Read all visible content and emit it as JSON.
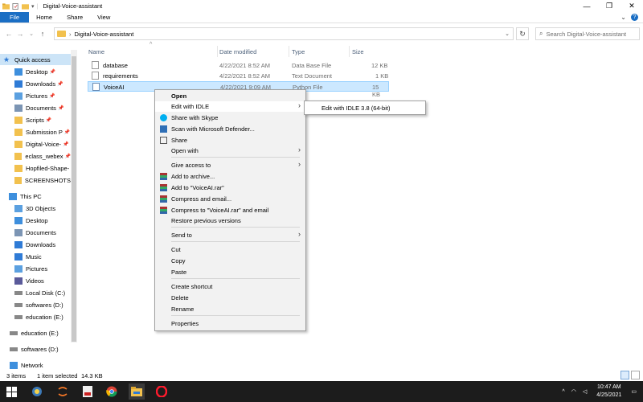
{
  "window": {
    "title": "Digital-Voice-assistant",
    "controls": {
      "minimize": "—",
      "maximize": "❐",
      "close": "✕"
    }
  },
  "ribbon": {
    "tabs": [
      {
        "label": "File"
      },
      {
        "label": "Home"
      },
      {
        "label": "Share"
      },
      {
        "label": "View"
      }
    ],
    "collapse_glyph": "⌄",
    "help_glyph": "?"
  },
  "address": {
    "back": "←",
    "forward": "→",
    "recent": "⌄",
    "up": "↑",
    "separator": "›",
    "path": "Digital-Voice-assistant",
    "dropdown": "⌄",
    "refresh": "↻",
    "search_placeholder": "Search Digital-Voice-assistant",
    "search_glyph": "⌕"
  },
  "nav": {
    "pin_glyph": "📌",
    "items": [
      {
        "label": "Quick access",
        "icon": "star-icon",
        "color": "#2f7bd6"
      },
      {
        "label": "Desktop",
        "icon": "desktop-icon",
        "color": "#3e8fdd",
        "pinned": true
      },
      {
        "label": "Downloads",
        "icon": "download-icon",
        "color": "#2f7bd6",
        "pinned": true
      },
      {
        "label": "Pictures",
        "icon": "pictures-icon",
        "color": "#5ba0e0",
        "pinned": true
      },
      {
        "label": "Documents",
        "icon": "documents-icon",
        "color": "#7c95b4",
        "pinned": true
      },
      {
        "label": "Scripts",
        "icon": "folder-icon",
        "color": "#f2c14e",
        "pinned": true
      },
      {
        "label": "Submission P",
        "icon": "folder-icon",
        "color": "#f2c14e",
        "pinned": true
      },
      {
        "label": "Digital-Voice-",
        "icon": "folder-icon",
        "color": "#f2c14e",
        "pinned": true
      },
      {
        "label": "eclass_webex",
        "icon": "folder-icon",
        "color": "#f2c14e",
        "pinned": true
      },
      {
        "label": "Hopfiled-Shape-",
        "icon": "folder-icon",
        "color": "#f2c14e"
      },
      {
        "label": "SCREENSHOTS",
        "icon": "folder-icon",
        "color": "#f2c14e"
      },
      {
        "label": "This PC",
        "icon": "pc-icon",
        "color": "#3e8fdd"
      },
      {
        "label": "3D Objects",
        "icon": "3d-objects-icon",
        "color": "#5ba0e0"
      },
      {
        "label": "Desktop",
        "icon": "desktop-icon",
        "color": "#3e8fdd"
      },
      {
        "label": "Documents",
        "icon": "documents-icon",
        "color": "#7c95b4"
      },
      {
        "label": "Downloads",
        "icon": "download-icon",
        "color": "#2f7bd6"
      },
      {
        "label": "Music",
        "icon": "music-icon",
        "color": "#2f7bd6"
      },
      {
        "label": "Pictures",
        "icon": "pictures-icon",
        "color": "#5ba0e0"
      },
      {
        "label": "Videos",
        "icon": "videos-icon",
        "color": "#5a5a9a"
      },
      {
        "label": "Local Disk (C:)",
        "icon": "drive-icon",
        "color": "#888888"
      },
      {
        "label": "softwares (D:)",
        "icon": "drive-icon",
        "color": "#888888"
      },
      {
        "label": "education (E:)",
        "icon": "drive-icon",
        "color": "#888888"
      },
      {
        "label": "education (E:)",
        "icon": "drive-icon",
        "color": "#888888"
      },
      {
        "label": "softwares (D:)",
        "icon": "drive-icon",
        "color": "#888888"
      },
      {
        "label": "Network",
        "icon": "network-icon",
        "color": "#3e8fdd"
      }
    ]
  },
  "files": {
    "sort_glyph": "^",
    "columns": [
      "Name",
      "Date modified",
      "Type",
      "Size"
    ],
    "rows": [
      {
        "name": "database",
        "date": "4/22/2021 8:52 AM",
        "type": "Data Base File",
        "size": "12 KB"
      },
      {
        "name": "requirements",
        "date": "4/22/2021 8:52 AM",
        "type": "Text Document",
        "size": "1 KB"
      },
      {
        "name": "VoiceAI",
        "date": "4/22/2021 9:09 AM",
        "type": "Python File",
        "size": "15 KB"
      }
    ]
  },
  "context_menu": {
    "arrow_glyph": "›",
    "items": [
      {
        "label": "Open",
        "bold": true
      },
      {
        "label": "Edit with IDLE",
        "submenu": true
      },
      {
        "label": "Share with Skype",
        "icon": "skype-icon"
      },
      {
        "label": "Scan with Microsoft Defender...",
        "icon": "defender-icon"
      },
      {
        "label": "Share",
        "icon": "share-icon"
      },
      {
        "label": "Open with",
        "submenu": true
      },
      {
        "label": "Give access to",
        "submenu": true
      },
      {
        "label": "Add to archive...",
        "icon": "winrar-icon"
      },
      {
        "label": "Add to \"VoiceAI.rar\"",
        "icon": "winrar-icon"
      },
      {
        "label": "Compress and email...",
        "icon": "winrar-icon"
      },
      {
        "label": "Compress to \"VoiceAI.rar\" and email",
        "icon": "winrar-icon"
      },
      {
        "label": "Restore previous versions"
      },
      {
        "label": "Send to",
        "submenu": true
      },
      {
        "label": "Cut"
      },
      {
        "label": "Copy"
      },
      {
        "label": "Paste"
      },
      {
        "label": "Create shortcut"
      },
      {
        "label": "Delete"
      },
      {
        "label": "Rename"
      },
      {
        "label": "Properties"
      }
    ],
    "submenu": {
      "label": "Edit with IDLE 3.8 (64-bit)"
    }
  },
  "status": {
    "items_count": "3 items",
    "selected": "1 item selected",
    "size": "14.3 KB"
  },
  "taskbar": {
    "tray_chevron": "^",
    "wifi_glyph": "◠",
    "volume_glyph": "◁",
    "time": "10:47 AM",
    "date": "4/25/2021",
    "notifications_glyph": "▭",
    "colors": {
      "background": "#1c1c1c"
    }
  },
  "colors": {
    "accent": "#1a6ec4",
    "selection": "#cce8ff",
    "nav_selected": "#cce4f7"
  }
}
